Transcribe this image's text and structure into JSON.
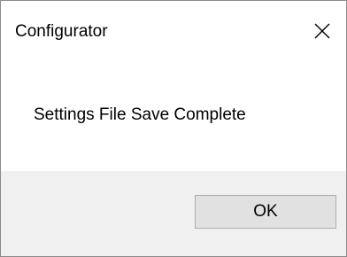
{
  "window": {
    "title": "Configurator",
    "close_icon": "close-icon"
  },
  "dialog": {
    "message": "Settings File Save Complete"
  },
  "buttons": {
    "ok_label": "OK"
  },
  "colors": {
    "content_bg": "#ffffff",
    "footer_bg": "#f0f0f0",
    "button_bg": "#e1e1e1",
    "button_border": "#adadad",
    "window_border": "#8a8a8a"
  }
}
